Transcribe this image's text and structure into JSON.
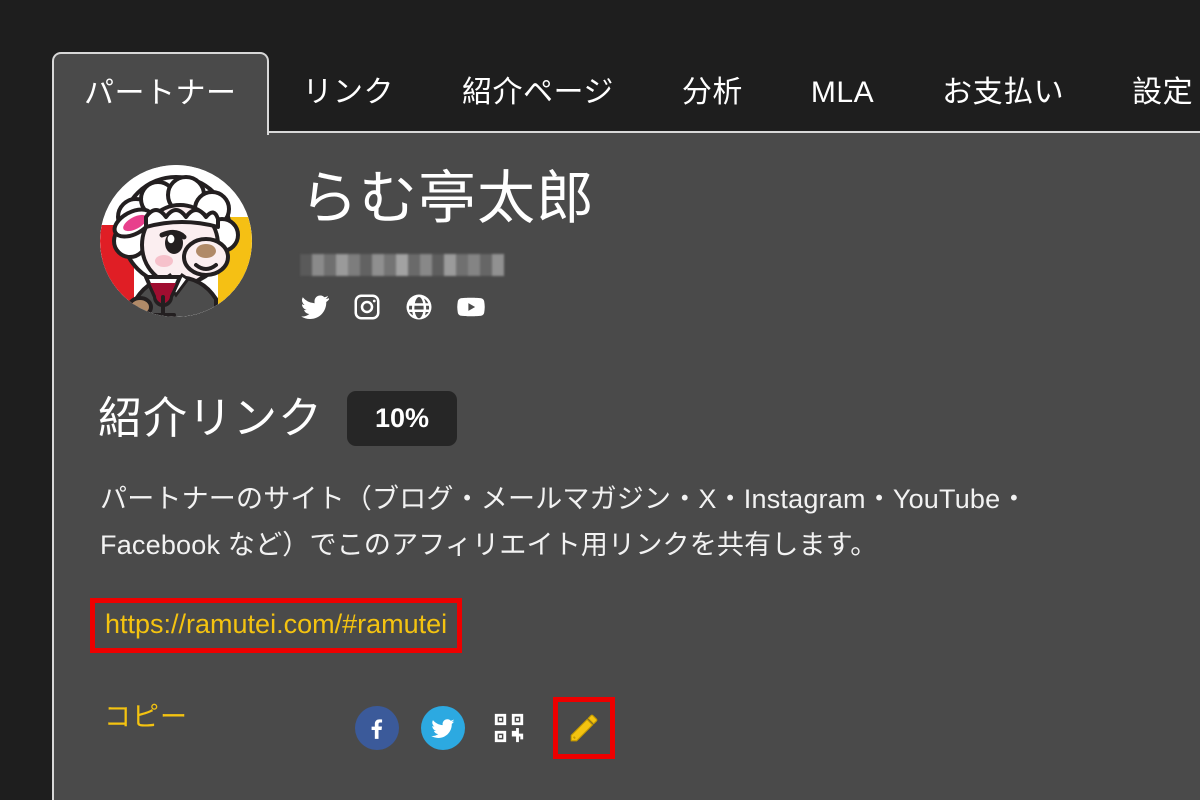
{
  "colors": {
    "page_background": "#1e1e1e",
    "panel_background": "#4a4a4a",
    "tab_border": "#d8d8d8",
    "accent_yellow": "#f4c310",
    "annotation_red": "#ee0000",
    "badge_background": "#262626",
    "facebook_blue": "#3b5a9a",
    "twitter_blue": "#2ca9e1"
  },
  "tabs": [
    {
      "label": "パートナー",
      "active": true
    },
    {
      "label": "リンク",
      "active": false
    },
    {
      "label": "紹介ページ",
      "active": false
    },
    {
      "label": "分析",
      "active": false
    },
    {
      "label": "MLA",
      "active": false
    },
    {
      "label": "お支払い",
      "active": false
    },
    {
      "label": "設定",
      "active": false
    }
  ],
  "profile": {
    "avatar_name": "sheep-avatar-image",
    "name": "らむ亭太郎",
    "email_redacted": "",
    "socials": [
      {
        "name": "twitter-icon",
        "label": "Twitter"
      },
      {
        "name": "instagram-icon",
        "label": "Instagram"
      },
      {
        "name": "website-icon",
        "label": "Website"
      },
      {
        "name": "youtube-icon",
        "label": "YouTube"
      }
    ]
  },
  "referral": {
    "title": "紹介リンク",
    "rate_badge": "10%",
    "description": "パートナーのサイト（ブログ・メールマガジン・X・Instagram・YouTube・Facebook など）でこのアフィリエイト用リンクを共有します。",
    "url": "https://ramutei.com/#ramutei",
    "copy_label": "コピー",
    "share_buttons": [
      {
        "name": "facebook-share-button",
        "label": "Facebook"
      },
      {
        "name": "twitter-share-button",
        "label": "Twitter"
      },
      {
        "name": "qr-code-button",
        "label": "QR"
      },
      {
        "name": "edit-link-button",
        "label": "編集"
      }
    ]
  }
}
